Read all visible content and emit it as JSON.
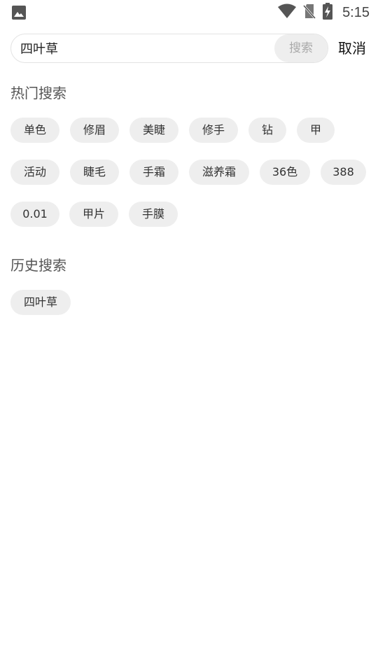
{
  "status_bar": {
    "time": "5:15",
    "icons": [
      "image-icon",
      "wifi-icon",
      "no-sim-icon",
      "battery-charging-icon"
    ]
  },
  "search": {
    "value": "四叶草",
    "button_label": "搜索",
    "cancel_label": "取消"
  },
  "hot": {
    "title": "热门搜索",
    "tags": [
      "单色",
      "修眉",
      "美睫",
      "修手",
      "钻",
      "甲",
      "活动",
      "睫毛",
      "手霜",
      "滋养霜",
      "36色",
      "388",
      "0.01",
      "甲片",
      "手膜"
    ]
  },
  "history": {
    "title": "历史搜索",
    "tags": [
      "四叶草"
    ]
  }
}
